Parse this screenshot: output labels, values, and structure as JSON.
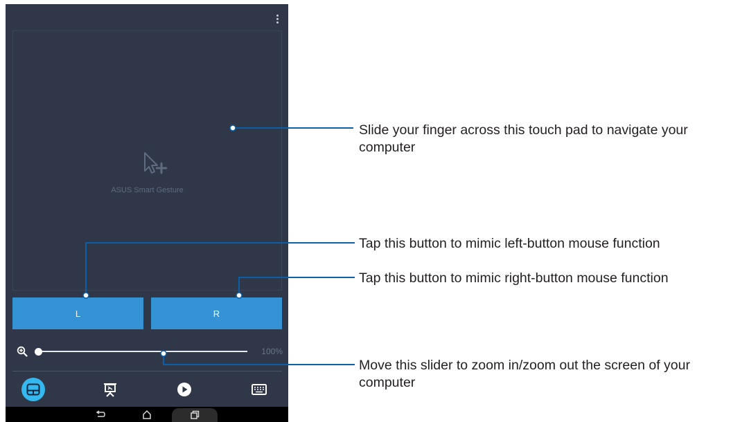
{
  "touchpad": {
    "label": "ASUS Smart Gesture",
    "logo_icon": "pointer-move-icon"
  },
  "buttons": {
    "left_label": "L",
    "right_label": "R"
  },
  "zoom": {
    "icon": "zoom-in-icon",
    "value_label": "100%",
    "level": 0
  },
  "bottom_nav": [
    {
      "id": "touchpad",
      "icon": "touchpad-icon",
      "active": true
    },
    {
      "id": "presentation",
      "icon": "presentation-icon",
      "active": false
    },
    {
      "id": "media",
      "icon": "play-icon",
      "active": false
    },
    {
      "id": "keyboard",
      "icon": "keyboard-icon",
      "active": false
    }
  ],
  "system_nav": [
    "back-icon",
    "home-icon",
    "recent-apps-icon"
  ],
  "callouts": {
    "touchpad": "Slide your finger across this touch pad to navigate your computer",
    "left_button": "Tap this button to mimic left-button mouse function",
    "right_button": "Tap this button to mimic right-button mouse function",
    "slider": "Move this slider to zoom in/zoom out the screen of your computer"
  },
  "colors": {
    "screen_bg": "#2f3748",
    "button_blue": "#3592d4",
    "active_tab": "#35b8ef",
    "callout_line": "#0b5ea8"
  }
}
